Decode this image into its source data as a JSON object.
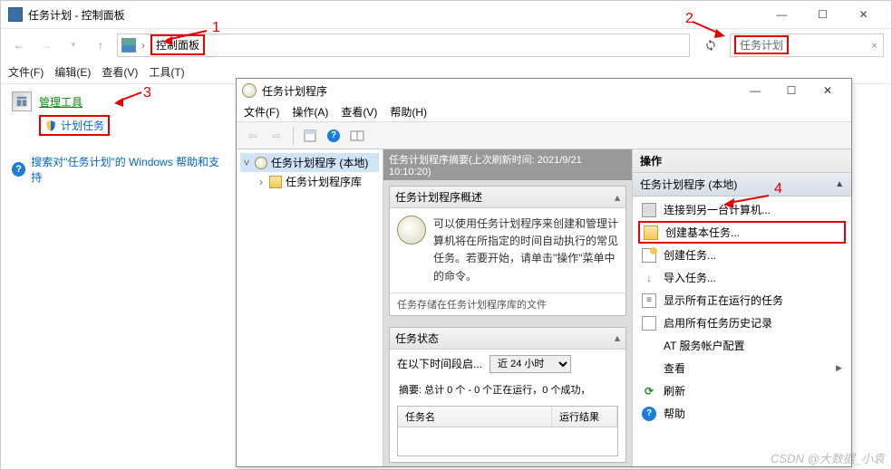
{
  "annotations": {
    "n1": "1",
    "n2": "2",
    "n3": "3",
    "n4": "4"
  },
  "cp": {
    "title": "任务计划 - 控制面板",
    "crumb": "控制面板",
    "search_ph": "任务计划",
    "menu": {
      "file": "文件(F)",
      "edit": "编辑(E)",
      "view": "查看(V)",
      "tools": "工具(T)"
    },
    "admin_tools": "管理工具",
    "schedule_tasks": "计划任务",
    "help_link": "搜索对\"任务计划\"的 Windows 帮助和支持"
  },
  "ts": {
    "title": "任务计划程序",
    "menu": {
      "file": "文件(F)",
      "action": "操作(A)",
      "view": "查看(V)",
      "help": "帮助(H)"
    },
    "tree": {
      "root": "任务计划程序 (本地)",
      "lib": "任务计划程序库"
    },
    "center": {
      "header": "任务计划程序摘要(上次刷新时间: 2021/9/21 10:10:20)",
      "overview_hdr": "任务计划程序概述",
      "overview_text": "可以使用任务计划程序来创建和管理计算机将在所指定的时间自动执行的常见任务。若要开始，请单击\"操作\"菜单中的命令。",
      "overview_cut": "任务存储在任务计划程序库的文件",
      "status_hdr": "任务状态",
      "status_label": "在以下时间段启...",
      "status_select": "近 24 小时",
      "summary": "摘要: 总计 0 个 - 0 个正在运行，0 个成功，",
      "col_name": "任务名",
      "col_result": "运行结果"
    },
    "actions": {
      "hdr": "操作",
      "sub": "任务计划程序 (本地)",
      "items": {
        "connect": "连接到另一台计算机...",
        "create_basic": "创建基本任务...",
        "create": "创建任务...",
        "import": "导入任务...",
        "show_running": "显示所有正在运行的任务",
        "enable_history": "启用所有任务历史记录",
        "at_service": "AT 服务帐户配置",
        "view": "查看",
        "refresh": "刷新",
        "help": "帮助"
      }
    }
  },
  "watermark": "CSDN @大数据_小袁"
}
